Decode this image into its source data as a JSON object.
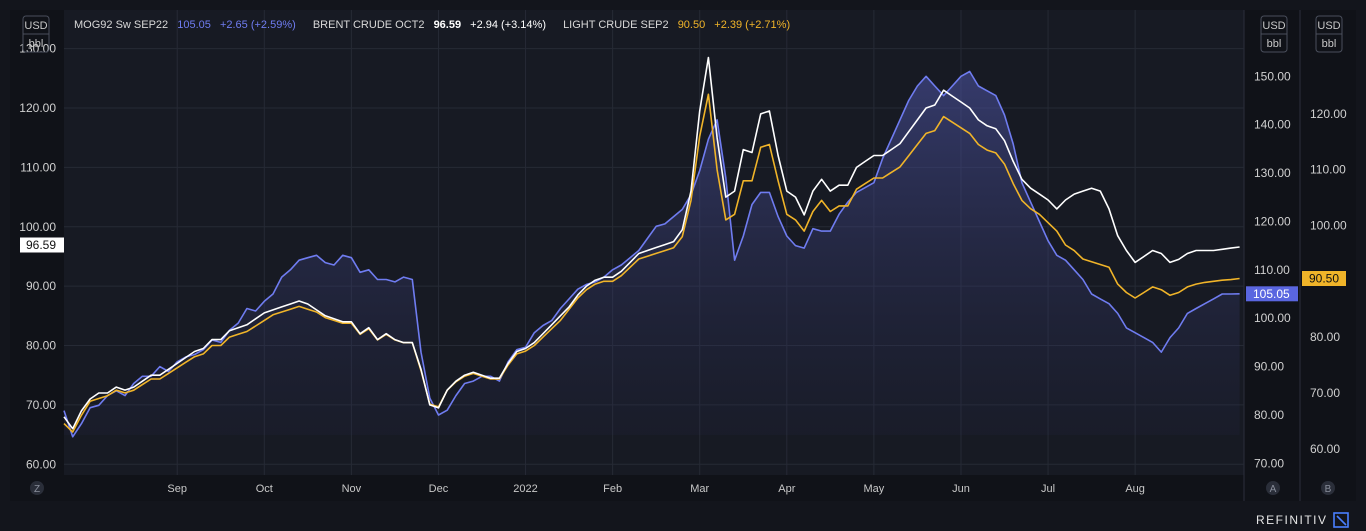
{
  "chart_data": {
    "type": "line",
    "legend": [
      {
        "name": "MOG92 Sw SEP22",
        "value": "105.05",
        "change": "+2.65 (+2.59%)",
        "color": "#6f7cf0"
      },
      {
        "name": "BRENT CRUDE OCT2",
        "value": "96.59",
        "change": "+2.94 (+3.14%)",
        "color": "#ffffff"
      },
      {
        "name": "LIGHT CRUDE SEP2",
        "value": "90.50",
        "change": "+2.39 (+2.71%)",
        "color": "#f0b429"
      }
    ],
    "unit_top": "USD",
    "unit_bottom": "bbl",
    "x_labels": [
      "Sep",
      "Oct",
      "Nov",
      "Dec",
      "2022",
      "Feb",
      "Mar",
      "Apr",
      "May",
      "Jun",
      "Jul",
      "Aug"
    ],
    "x_positions": [
      1.3,
      2.3,
      3.3,
      4.3,
      5.3,
      6.3,
      7.3,
      8.3,
      9.3,
      10.3,
      11.3,
      12.3
    ],
    "x_range": [
      0,
      13.55
    ],
    "left_axis": {
      "ticks": [
        60,
        70,
        80,
        90,
        100,
        110,
        120,
        130
      ],
      "range": [
        58.2,
        136.5
      ],
      "labels": [
        "60.00",
        "70.00",
        "80.00",
        "90.00",
        "100.00",
        "110.00",
        "120.00",
        "130.00"
      ]
    },
    "mid_axis": {
      "ticks": [
        70,
        80,
        90,
        100,
        110,
        120,
        130,
        140,
        150
      ],
      "range": [
        67.6,
        163.7
      ],
      "labels": [
        "70.00",
        "80.00",
        "90.00",
        "100.00",
        "110.00",
        "120.00",
        "130.00",
        "140.00",
        "150.00"
      ]
    },
    "right_axis": {
      "ticks": [
        60,
        70,
        80,
        90,
        100,
        110,
        120
      ],
      "range": [
        55.3,
        138.6
      ],
      "labels": [
        "60.00",
        "70.00",
        "80.00",
        "90.00",
        "100.00",
        "110.00",
        "120.00"
      ]
    },
    "last_value_tags": {
      "left": "96.59",
      "mid": "105.05",
      "right": "90.50"
    },
    "series": [
      {
        "name": "MOG92 Sw SEP22",
        "axis": "mid",
        "color": "#6f7cf0",
        "fill": true,
        "x": [
          0,
          0.1,
          0.2,
          0.3,
          0.4,
          0.5,
          0.6,
          0.7,
          0.8,
          0.9,
          1.0,
          1.1,
          1.2,
          1.3,
          1.4,
          1.5,
          1.6,
          1.7,
          1.8,
          1.9,
          2.0,
          2.1,
          2.2,
          2.3,
          2.4,
          2.5,
          2.6,
          2.7,
          2.8,
          2.9,
          3.0,
          3.1,
          3.2,
          3.3,
          3.4,
          3.5,
          3.6,
          3.7,
          3.8,
          3.9,
          4.0,
          4.1,
          4.2,
          4.3,
          4.4,
          4.5,
          4.6,
          4.7,
          4.8,
          4.9,
          5.0,
          5.1,
          5.2,
          5.3,
          5.4,
          5.5,
          5.6,
          5.7,
          5.8,
          5.9,
          6.0,
          6.1,
          6.2,
          6.3,
          6.4,
          6.5,
          6.6,
          6.7,
          6.8,
          6.9,
          7.0,
          7.1,
          7.2,
          7.3,
          7.4,
          7.5,
          7.6,
          7.7,
          7.8,
          7.9,
          8.0,
          8.1,
          8.2,
          8.3,
          8.4,
          8.5,
          8.6,
          8.7,
          8.8,
          8.9,
          9.0,
          9.1,
          9.2,
          9.3,
          9.4,
          9.5,
          9.6,
          9.7,
          9.8,
          9.9,
          10.0,
          10.1,
          10.2,
          10.3,
          10.4,
          10.5,
          10.6,
          10.7,
          10.8,
          10.9,
          11.0,
          11.1,
          11.2,
          11.3,
          11.4,
          11.5,
          11.6,
          11.7,
          11.8,
          11.9,
          12.0,
          12.1,
          12.2,
          12.3,
          12.4,
          12.5,
          12.6,
          12.7,
          12.8,
          12.9,
          13.0,
          13.1,
          13.2,
          13.3,
          13.4,
          13.5
        ],
        "y": [
          80.9,
          75.5,
          78.2,
          81.5,
          82.0,
          84.0,
          85.0,
          84.0,
          86.5,
          88.0,
          88.0,
          90.0,
          89.0,
          91.0,
          92.0,
          92.5,
          93.5,
          95.5,
          95.0,
          97.5,
          99.0,
          102.0,
          101.5,
          103.5,
          105.0,
          108.5,
          110.0,
          112.0,
          112.5,
          113.0,
          111.5,
          111.0,
          113.0,
          112.5,
          109.5,
          110.0,
          108.0,
          108.0,
          107.5,
          108.5,
          108.0,
          93.0,
          83.5,
          80.0,
          81.0,
          84.0,
          86.5,
          87.0,
          88.0,
          88.0,
          87.0,
          91.0,
          93.5,
          94.0,
          97.0,
          98.5,
          99.5,
          102.0,
          104.0,
          106.0,
          107.0,
          107.5,
          108.5,
          110.0,
          111.0,
          112.5,
          114.0,
          116.5,
          119.0,
          119.5,
          121.0,
          122.5,
          125.5,
          130.5,
          137.0,
          141.0,
          129.0,
          112.0,
          117.0,
          123.5,
          126.0,
          126.0,
          121.0,
          117.0,
          115.0,
          114.5,
          118.5,
          118.0,
          118.0,
          121.5,
          124.0,
          126.0,
          127.0,
          128.0,
          133.0,
          137.0,
          141.0,
          145.0,
          148.0,
          150.0,
          148.0,
          146.0,
          148.0,
          150.0,
          151.0,
          148.0,
          147.0,
          146.0,
          142.0,
          136.0,
          128.0,
          124.0,
          120.0,
          116.0,
          113.0,
          112.0,
          110.0,
          108.0,
          105.0,
          104.0,
          103.0,
          101.0,
          98.0,
          97.0,
          96.0,
          95.0,
          93.0,
          96.0,
          98.0,
          101.0,
          102.0,
          103.0,
          104.0,
          105.0,
          105.0,
          105.05
        ]
      },
      {
        "name": "BRENT CRUDE OCT2",
        "axis": "left",
        "color": "#ffffff",
        "x": [
          0,
          0.1,
          0.2,
          0.3,
          0.4,
          0.5,
          0.6,
          0.7,
          0.8,
          0.9,
          1.0,
          1.1,
          1.2,
          1.3,
          1.4,
          1.5,
          1.6,
          1.7,
          1.8,
          1.9,
          2.0,
          2.1,
          2.2,
          2.3,
          2.4,
          2.5,
          2.6,
          2.7,
          2.8,
          2.9,
          3.0,
          3.1,
          3.2,
          3.3,
          3.4,
          3.5,
          3.6,
          3.7,
          3.8,
          3.9,
          4.0,
          4.1,
          4.2,
          4.3,
          4.4,
          4.5,
          4.6,
          4.7,
          4.8,
          4.9,
          5.0,
          5.1,
          5.2,
          5.3,
          5.4,
          5.5,
          5.6,
          5.7,
          5.8,
          5.9,
          6.0,
          6.1,
          6.2,
          6.3,
          6.4,
          6.5,
          6.6,
          6.7,
          6.8,
          6.9,
          7.0,
          7.1,
          7.2,
          7.3,
          7.4,
          7.5,
          7.6,
          7.7,
          7.8,
          7.9,
          8.0,
          8.1,
          8.2,
          8.3,
          8.4,
          8.5,
          8.6,
          8.7,
          8.8,
          8.9,
          9.0,
          9.1,
          9.2,
          9.3,
          9.4,
          9.5,
          9.6,
          9.7,
          9.8,
          9.9,
          10.0,
          10.1,
          10.2,
          10.3,
          10.4,
          10.5,
          10.6,
          10.7,
          10.8,
          10.9,
          11.0,
          11.1,
          11.2,
          11.3,
          11.4,
          11.5,
          11.6,
          11.7,
          11.8,
          11.9,
          12.0,
          12.1,
          12.2,
          12.3,
          12.4,
          12.5,
          12.6,
          12.7,
          12.8,
          12.9,
          13.0,
          13.1,
          13.2,
          13.3,
          13.4,
          13.5
        ],
        "y": [
          68.0,
          66.0,
          69.0,
          71.0,
          72.0,
          72.0,
          73.0,
          72.5,
          73.0,
          74.0,
          75.0,
          75.0,
          76.0,
          77.0,
          78.0,
          79.0,
          79.5,
          81.0,
          81.0,
          82.5,
          83.0,
          83.5,
          84.5,
          85.5,
          86.0,
          86.5,
          87.0,
          87.5,
          87.0,
          86.0,
          85.0,
          84.5,
          84.0,
          84.0,
          82.0,
          83.0,
          81.0,
          82.0,
          81.0,
          80.5,
          80.5,
          76.0,
          70.0,
          69.5,
          72.5,
          74.0,
          75.0,
          75.5,
          75.0,
          74.5,
          74.5,
          77.0,
          79.0,
          79.5,
          80.5,
          82.0,
          83.5,
          85.0,
          86.5,
          88.5,
          90.0,
          91.0,
          91.5,
          91.5,
          92.5,
          94.0,
          95.5,
          96.0,
          96.5,
          97.0,
          97.5,
          99.5,
          106.0,
          119.5,
          128.5,
          115.0,
          105.0,
          106.0,
          113.0,
          112.5,
          119.0,
          119.5,
          112.0,
          106.0,
          105.0,
          102.0,
          106.0,
          108.0,
          106.0,
          107.0,
          107.0,
          110.0,
          111.0,
          112.0,
          112.0,
          113.0,
          114.0,
          116.0,
          118.0,
          120.0,
          120.5,
          123.0,
          122.0,
          121.0,
          120.0,
          118.0,
          117.0,
          116.5,
          114.5,
          111.0,
          108.0,
          106.5,
          105.5,
          104.5,
          103.0,
          104.5,
          105.5,
          106.0,
          106.5,
          106.0,
          103.0,
          98.5,
          96.0,
          94.0,
          95.0,
          96.0,
          95.5,
          94.0,
          94.5,
          95.5,
          96.0,
          96.0,
          96.0,
          96.2,
          96.4,
          96.59
        ]
      },
      {
        "name": "LIGHT CRUDE SEP2",
        "axis": "right",
        "color": "#f0b429",
        "x": [
          0,
          0.1,
          0.2,
          0.3,
          0.4,
          0.5,
          0.6,
          0.7,
          0.8,
          0.9,
          1.0,
          1.1,
          1.2,
          1.3,
          1.4,
          1.5,
          1.6,
          1.7,
          1.8,
          1.9,
          2.0,
          2.1,
          2.2,
          2.3,
          2.4,
          2.5,
          2.6,
          2.7,
          2.8,
          2.9,
          3.0,
          3.1,
          3.2,
          3.3,
          3.4,
          3.5,
          3.6,
          3.7,
          3.8,
          3.9,
          4.0,
          4.1,
          4.2,
          4.3,
          4.4,
          4.5,
          4.6,
          4.7,
          4.8,
          4.9,
          5.0,
          5.1,
          5.2,
          5.3,
          5.4,
          5.5,
          5.6,
          5.7,
          5.8,
          5.9,
          6.0,
          6.1,
          6.2,
          6.3,
          6.4,
          6.5,
          6.6,
          6.7,
          6.8,
          6.9,
          7.0,
          7.1,
          7.2,
          7.3,
          7.4,
          7.5,
          7.6,
          7.7,
          7.8,
          7.9,
          8.0,
          8.1,
          8.2,
          8.3,
          8.4,
          8.5,
          8.6,
          8.7,
          8.8,
          8.9,
          9.0,
          9.1,
          9.2,
          9.3,
          9.4,
          9.5,
          9.6,
          9.7,
          9.8,
          9.9,
          10.0,
          10.1,
          10.2,
          10.3,
          10.4,
          10.5,
          10.6,
          10.7,
          10.8,
          10.9,
          11.0,
          11.1,
          11.2,
          11.3,
          11.4,
          11.5,
          11.6,
          11.7,
          11.8,
          11.9,
          12.0,
          12.1,
          12.2,
          12.3,
          12.4,
          12.5,
          12.6,
          12.7,
          12.8,
          12.9,
          13.0,
          13.1,
          13.2,
          13.3,
          13.4,
          13.5
        ],
        "y": [
          64.5,
          63.0,
          66.0,
          68.5,
          69.0,
          69.5,
          70.5,
          70.0,
          70.5,
          71.5,
          72.5,
          72.5,
          73.5,
          74.5,
          75.5,
          76.5,
          77.0,
          78.5,
          78.5,
          80.0,
          80.5,
          81.0,
          82.0,
          83.0,
          84.0,
          84.5,
          85.0,
          85.5,
          85.0,
          84.5,
          83.5,
          83.0,
          82.5,
          82.5,
          80.5,
          81.5,
          79.5,
          80.5,
          79.5,
          79.0,
          79.0,
          74.0,
          68.0,
          67.5,
          70.5,
          72.0,
          73.0,
          73.5,
          73.0,
          72.5,
          72.5,
          75.0,
          77.0,
          77.5,
          78.5,
          80.0,
          81.5,
          83.0,
          85.0,
          87.0,
          88.5,
          89.5,
          90.0,
          90.0,
          91.0,
          92.5,
          94.0,
          94.5,
          95.0,
          95.5,
          96.0,
          98.0,
          104.5,
          116.0,
          123.5,
          110.0,
          101.0,
          102.0,
          108.0,
          108.0,
          114.0,
          114.5,
          108.0,
          102.0,
          101.0,
          99.0,
          102.5,
          104.5,
          102.5,
          103.5,
          103.5,
          106.5,
          107.5,
          108.5,
          108.5,
          109.5,
          110.5,
          112.5,
          114.5,
          116.5,
          117.0,
          119.5,
          118.5,
          117.5,
          116.5,
          114.5,
          113.5,
          113.0,
          111.0,
          107.5,
          104.5,
          103.0,
          102.0,
          100.5,
          99.0,
          96.5,
          95.5,
          94.0,
          93.5,
          93.0,
          92.5,
          89.5,
          88.0,
          87.0,
          88.0,
          89.0,
          88.5,
          87.5,
          88.0,
          89.0,
          89.5,
          89.8,
          90.0,
          90.2,
          90.3,
          90.5
        ]
      }
    ]
  },
  "toolbar": {
    "left_btn": "Z",
    "mid_btn": "A",
    "right_btn": "B"
  },
  "brand": "REFINITIV"
}
